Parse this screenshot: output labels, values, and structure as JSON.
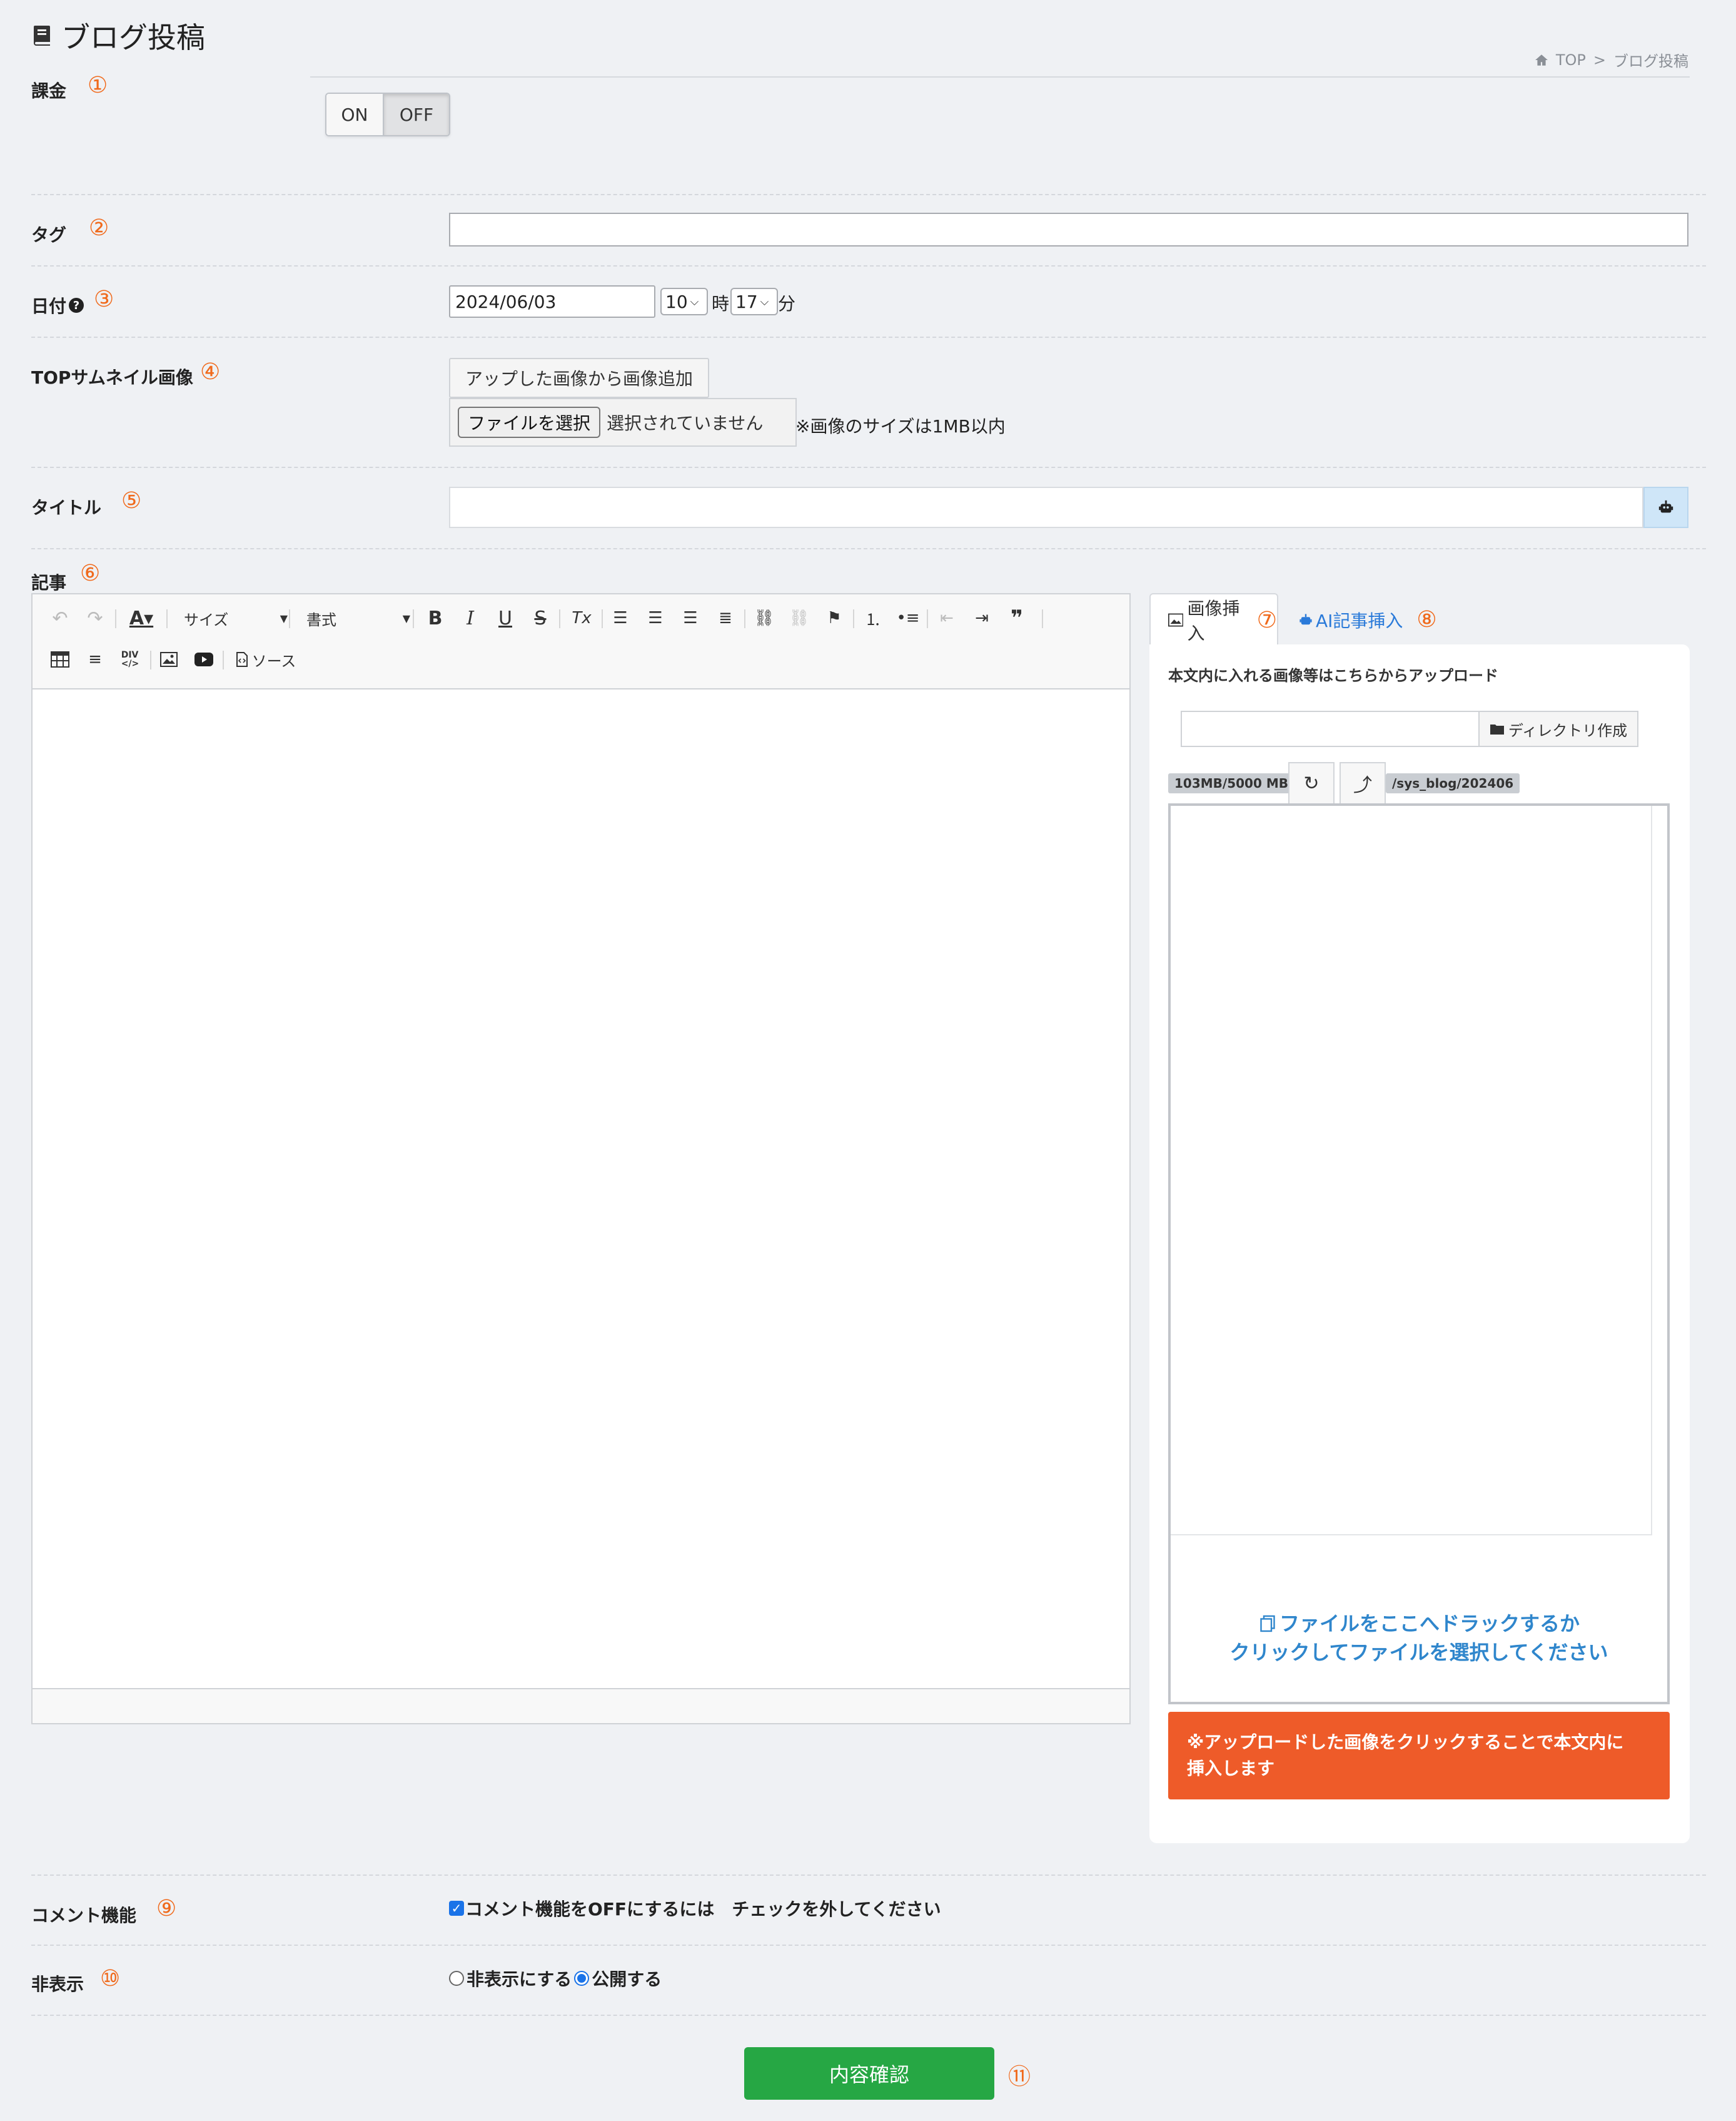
{
  "header": {
    "title": "ブログ投稿",
    "breadcrumb_home": "TOP",
    "breadcrumb_sep": ">",
    "breadcrumb_current": "ブログ投稿"
  },
  "billing": {
    "label": "課金",
    "marker": "①",
    "on_label": "ON",
    "off_label": "OFF",
    "selected": "OFF"
  },
  "tag": {
    "label": "タグ",
    "marker": "②",
    "value": ""
  },
  "date": {
    "label": "日付",
    "marker": "③",
    "value": "2024/06/03",
    "hour": "10",
    "hour_unit": "時",
    "minute": "17",
    "minute_unit": "分"
  },
  "thumbnail": {
    "label": "TOPサムネイル画像",
    "marker": "④",
    "add_from_uploaded": "アップした画像から画像追加",
    "choose_file": "ファイルを選択",
    "no_file": "選択されていません",
    "size_note": "※画像のサイズは1MB以内"
  },
  "title": {
    "label": "タイトル",
    "marker": "⑤",
    "value": ""
  },
  "article": {
    "label": "記事",
    "marker": "⑥",
    "toolbar": {
      "size_label": "サイズ",
      "format_label": "書式",
      "source_label": "ソース",
      "bold": "B",
      "italic": "I",
      "underline": "U",
      "strike": "S",
      "clear": "Tx"
    }
  },
  "side_panel": {
    "tab_image": "画像挿入",
    "tab_image_marker": "⑦",
    "tab_ai": "AI記事挿入",
    "tab_ai_marker": "⑧",
    "description": "本文内に入れる画像等はこちらからアップロード",
    "dir_button": "ディレクトリ作成",
    "usage": "103MB/5000 MB",
    "path": "/sys_blog/202406",
    "drop_line1": "ファイルをここへドラックするか",
    "drop_line2": "クリックしてファイルを選択してください",
    "notice_line1": "※アップロードした画像をクリックすることで本文内に",
    "notice_line2": "挿入します"
  },
  "comment": {
    "label": "コメント機能",
    "marker": "⑨",
    "checkbox_label": "コメント機能をOFFにするには　チェックを外してください",
    "checked": true
  },
  "visibility": {
    "label": "非表示",
    "marker": "⑩",
    "hide_label": "非表示にする",
    "public_label": "公開する",
    "selected": "公開する"
  },
  "submit": {
    "label": "内容確認",
    "marker": "⑪"
  },
  "colors": {
    "accent_orange": "#f06a1c",
    "submit_green": "#26a744",
    "notice_red": "#ee5b29",
    "link_blue": "#2a7ad9"
  }
}
